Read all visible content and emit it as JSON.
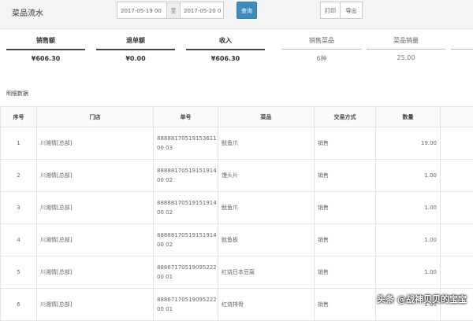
{
  "header": {
    "title": "菜品流水",
    "start_date": "2017-05-19 00",
    "separator": "至",
    "end_date": "2017-05-20 0",
    "query_label": "查询",
    "print_label": "打印",
    "export_label": "导出"
  },
  "summary": [
    {
      "label": "销售额",
      "value": "¥606.30"
    },
    {
      "label": "退单额",
      "value": "¥0.00"
    },
    {
      "label": "收入",
      "value": "¥606.30"
    },
    {
      "label": "销售菜品",
      "value": "6种"
    },
    {
      "label": "菜品销量",
      "value": "25.00"
    }
  ],
  "detail_title": "明细数据",
  "table": {
    "headers": [
      "序号",
      "门店",
      "单号",
      "菜品",
      "交易方式",
      "数量"
    ],
    "rows": [
      [
        "1",
        "川湘情[总部]",
        "8888817051915361100 03",
        "鱿鱼爪",
        "销售",
        "19.00"
      ],
      [
        "2",
        "川湘情[总部]",
        "8888817051915191400 02",
        "馒头片",
        "销售",
        "1.00"
      ],
      [
        "3",
        "川湘情[总部]",
        "8888817051915191400 02",
        "鱿鱼爪",
        "销售",
        "1.00"
      ],
      [
        "4",
        "川湘情[总部]",
        "8888817051915191400 02",
        "鱿鱼板",
        "销售",
        "1.00"
      ],
      [
        "5",
        "川湘情[总部]",
        "8886717051909522200 01",
        "红烧日本豆腐",
        "销售",
        "1.00"
      ],
      [
        "6",
        "川湘情[总部]",
        "8886717051909522200 01",
        "红烧排骨",
        "销售",
        "1.00"
      ]
    ]
  },
  "watermark": "头条 @战神贝贝的宝宝"
}
